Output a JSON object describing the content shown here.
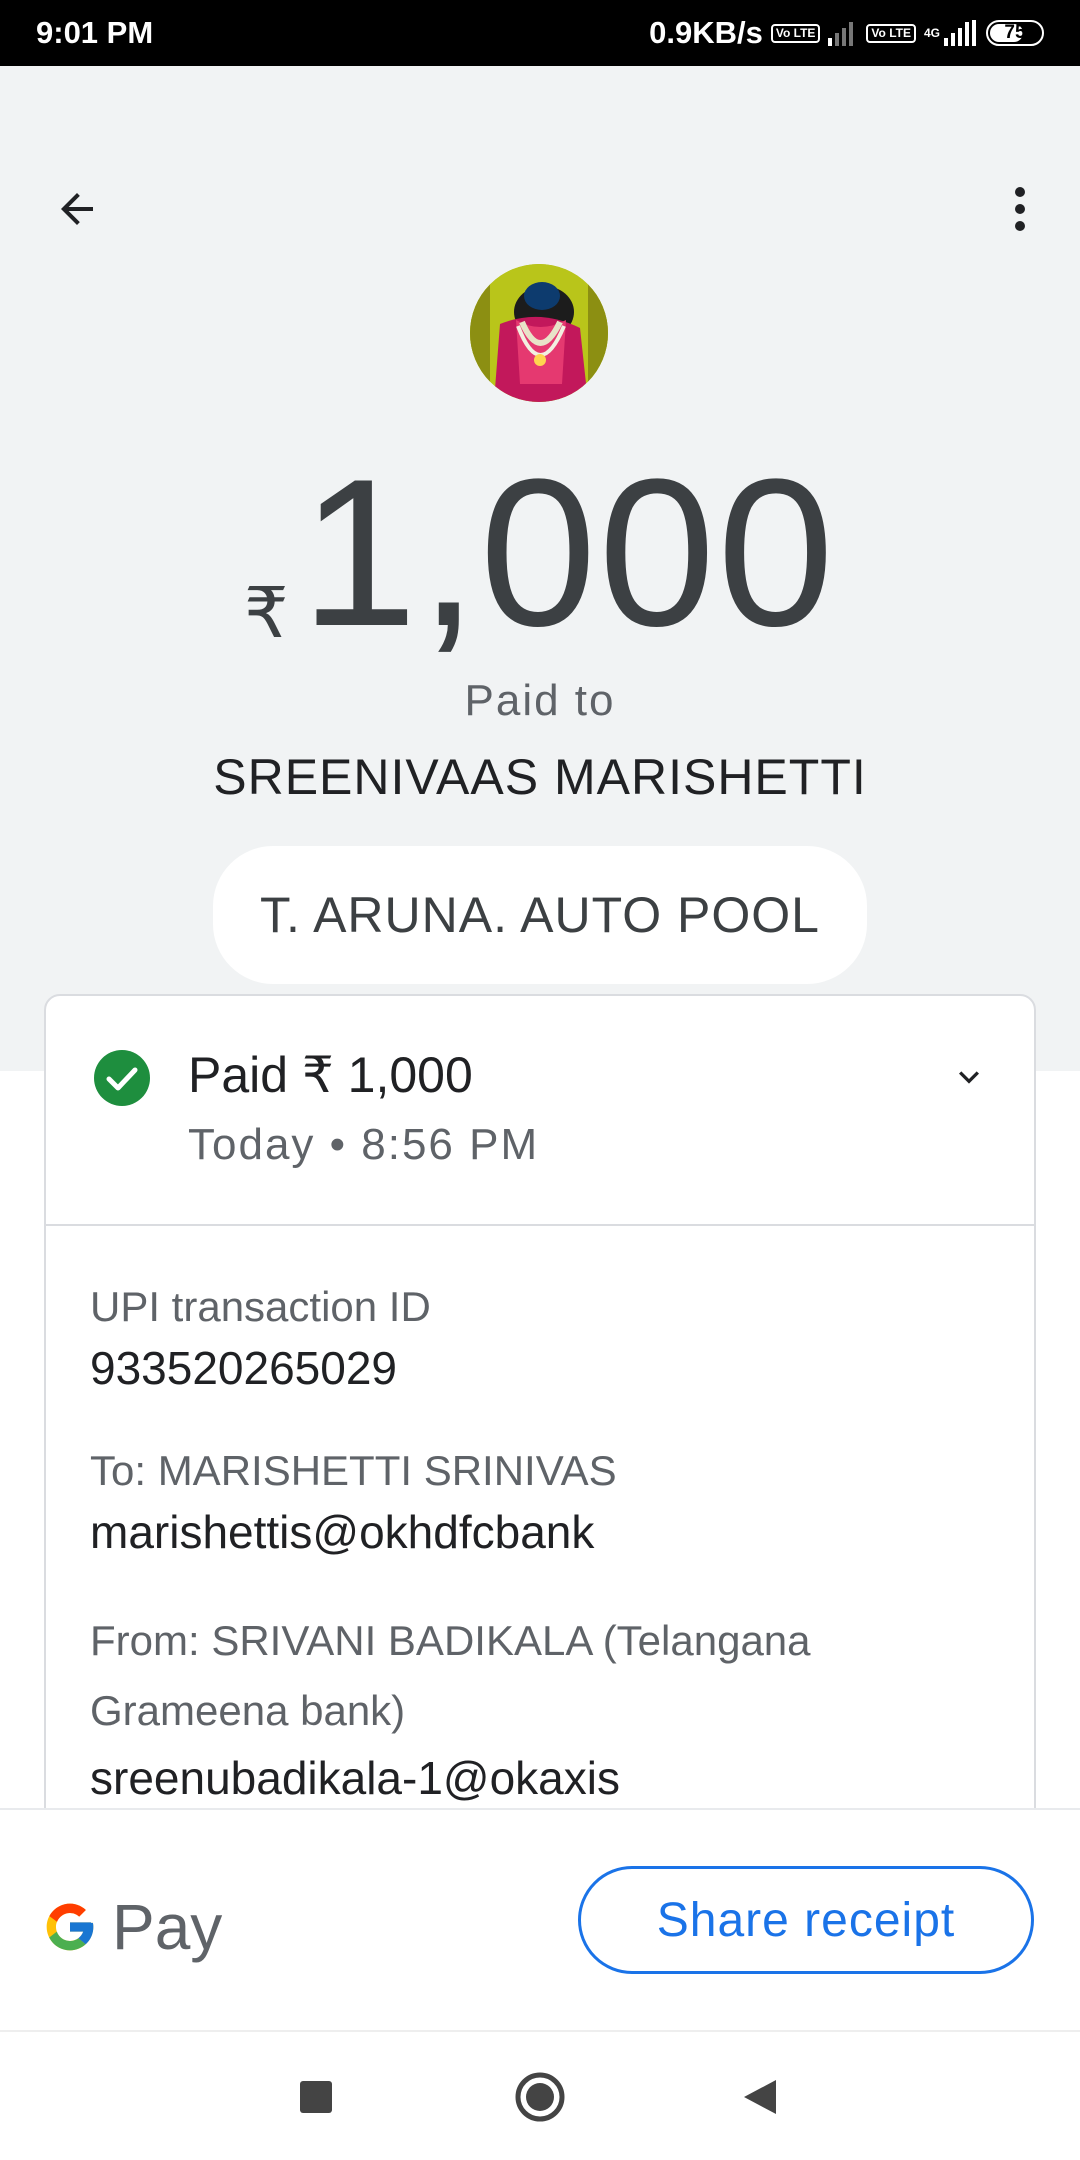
{
  "status_bar": {
    "time": "9:01 PM",
    "speed": "0.9KB/s",
    "volte_1": "Vo LTE",
    "volte_2": "Vo LTE",
    "network_type": "4G",
    "battery": "75"
  },
  "payment": {
    "currency_symbol": "₹",
    "amount": "1,000",
    "paid_to_label": "Paid to",
    "payee_name": "SREENIVAAS MARISHETTI",
    "note": "T. ARUNA. AUTO POOL"
  },
  "summary": {
    "title": "Paid ₹ 1,000",
    "time": "Today • 8:56 PM"
  },
  "details": {
    "upi_label": "UPI transaction ID",
    "upi_id": "933520265029",
    "to_label": "To: MARISHETTI SRINIVAS",
    "to_value": "marishettis@okhdfcbank",
    "from_label": "From: SRIVANI BADIKALA (Telangana Grameena bank)",
    "from_value": "sreenubadikala-1@okaxis"
  },
  "footer": {
    "logo_text": "Pay",
    "share_label": "Share receipt"
  },
  "icons": {
    "back": "arrow-back-icon",
    "menu": "more-vert-icon",
    "check": "check-circle-icon",
    "expand": "chevron-down-icon",
    "nav_square": "recents-icon",
    "nav_circle": "home-icon",
    "nav_triangle": "back-icon"
  },
  "colors": {
    "accent": "#1a73e8",
    "success": "#188038",
    "header_bg": "#f1f3f4"
  }
}
